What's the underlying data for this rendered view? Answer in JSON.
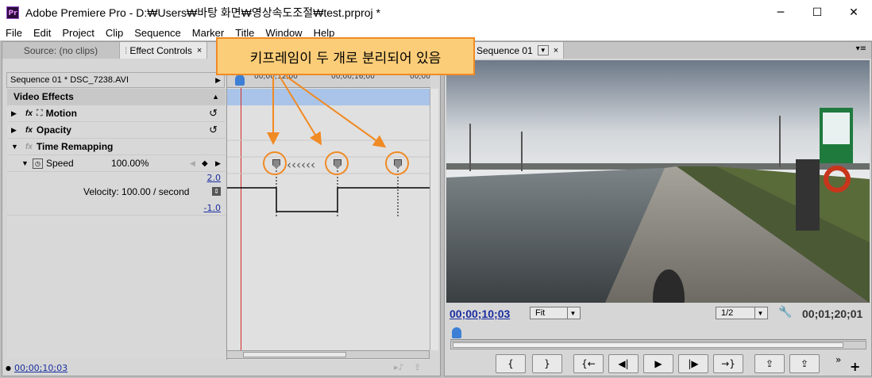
{
  "window": {
    "title": "Adobe Premiere Pro - D:₩Users₩바탕 화면₩영상속도조절₩test.prproj *",
    "app_icon": "Pr",
    "minimize": "─",
    "maximize": "☐",
    "close": "✕"
  },
  "menu": [
    "File",
    "Edit",
    "Project",
    "Clip",
    "Sequence",
    "Marker",
    "Title",
    "Window",
    "Help"
  ],
  "left_panel": {
    "tabs": [
      {
        "label": "Source: (no clips)"
      },
      {
        "label": "Effect Controls",
        "close": "×"
      }
    ],
    "sequence_clip": "Sequence 01 * DSC_7238.AVI",
    "ruler_times": [
      "00;00;12;00",
      "00;00;16;00",
      "00;00"
    ],
    "video_effects_header": "Video Effects",
    "effects": [
      {
        "label": "Motion",
        "fx": "fx"
      },
      {
        "label": "Opacity",
        "fx": "fx"
      },
      {
        "label": "Time Remapping",
        "fx": "fx"
      }
    ],
    "speed": {
      "label": "Speed",
      "value": "100.00%"
    },
    "graph_max": "2.0",
    "velocity": "Velocity: 100.00 / second",
    "graph_min": "-1.0",
    "current_time": "00;00;10;03"
  },
  "callout": {
    "text": "키프레임이 두 개로 분리되어 있음"
  },
  "program_monitor": {
    "tab_label": "gram: Sequence 01",
    "timecode": "00;00;10;03",
    "fit": "Fit",
    "resolution": "1/2",
    "duration": "00;01;20;01"
  },
  "transport_buttons": [
    "{",
    "}",
    "{←",
    "◀|",
    "▶",
    "|▶",
    "→}",
    "⇪",
    "⇪"
  ],
  "colors": {
    "accent": "#f08a24",
    "callout_bg": "#fccd78",
    "timecode_blue": "#1a2ea0",
    "playhead": "#d42a2a"
  }
}
